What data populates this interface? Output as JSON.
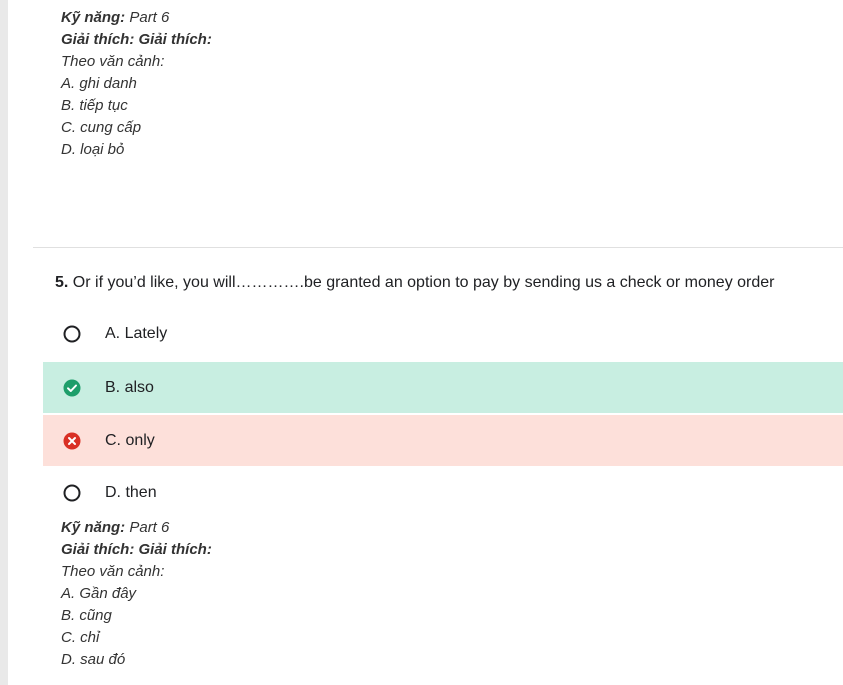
{
  "previous_explanation": {
    "skill_label": "Kỹ năng:",
    "skill_value": "Part 6",
    "explain_label": "Giải thích: Giải thích:",
    "context": "Theo văn cảnh:",
    "options": [
      "A. ghi danh",
      "B. tiếp tục",
      "C. cung cấp",
      "D. loại bỏ"
    ]
  },
  "question": {
    "number": "5.",
    "text": "Or if you’d like, you will………….be granted an option to pay by sending us a check or money order",
    "options": [
      {
        "label": "A. Lately",
        "state": "unselected"
      },
      {
        "label": "B. also",
        "state": "correct"
      },
      {
        "label": "C. only",
        "state": "wrong"
      },
      {
        "label": "D. then",
        "state": "unselected"
      }
    ]
  },
  "explanation": {
    "skill_label": "Kỹ năng:",
    "skill_value": "Part 6",
    "explain_label": "Giải thích: Giải thích:",
    "context": "Theo văn cảnh:",
    "options": [
      "A. Gần đây",
      "B. cũng",
      "C. chỉ",
      "D. sau đó"
    ]
  },
  "colors": {
    "correct_bg": "#c8eee1",
    "wrong_bg": "#fde0da",
    "correct_icon": "#1e9e6a",
    "wrong_icon": "#d93025"
  },
  "icons": {
    "unselected": "radio-empty-icon",
    "correct": "check-circle-icon",
    "wrong": "x-circle-icon"
  }
}
